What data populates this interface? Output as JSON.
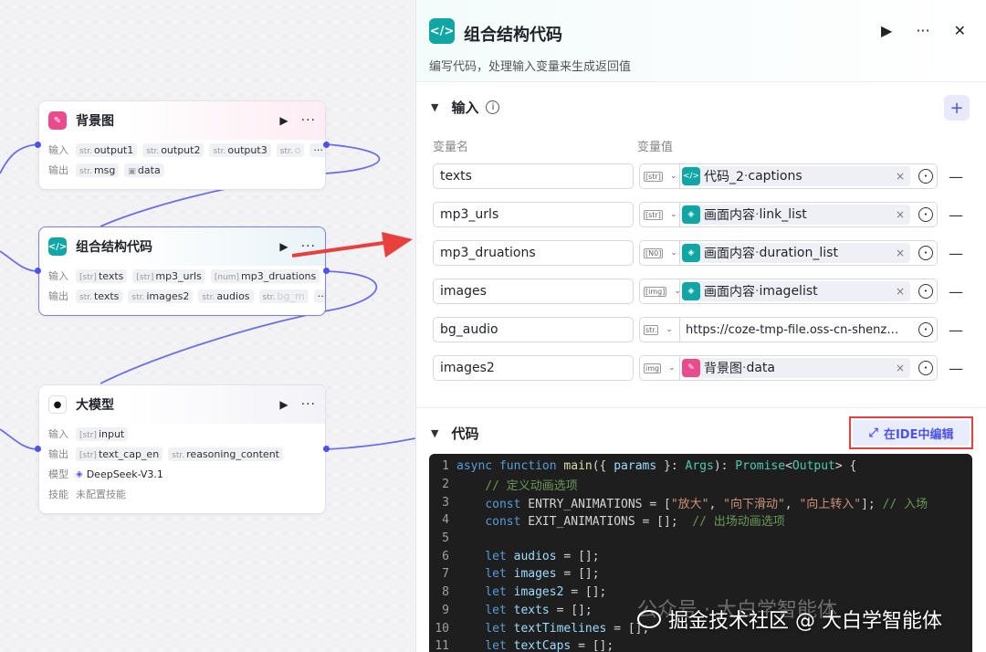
{
  "canvas": {
    "nodes": [
      {
        "title": "背景图",
        "in_label": "输入",
        "out_label": "输出",
        "inputs": [
          {
            "type": "str.",
            "name": "output1"
          },
          {
            "type": "str.",
            "name": "output2"
          },
          {
            "type": "str.",
            "name": "output3"
          },
          {
            "type": "str.",
            "name": "o"
          }
        ],
        "outputs": [
          {
            "type": "str.",
            "name": "msg"
          },
          {
            "type": "img",
            "name": "data"
          }
        ]
      },
      {
        "title": "组合结构代码",
        "in_label": "输入",
        "out_label": "输出",
        "inputs": [
          {
            "type": "[str]",
            "name": "texts"
          },
          {
            "type": "[str]",
            "name": "mp3_urls"
          },
          {
            "type": "[num]",
            "name": "mp3_druations"
          }
        ],
        "outputs": [
          {
            "type": "str.",
            "name": "texts"
          },
          {
            "type": "str.",
            "name": "images2"
          },
          {
            "type": "str.",
            "name": "audios"
          },
          {
            "type": "str.",
            "name": "bg_m"
          }
        ]
      },
      {
        "title": "大模型",
        "in_label": "输入",
        "out_label": "输出",
        "model_label": "模型",
        "model": "DeepSeek-V3.1",
        "skill_label": "技能",
        "skill": "未配置技能",
        "inputs": [
          {
            "type": "[str]",
            "name": "input"
          }
        ],
        "outputs": [
          {
            "type": "[str]",
            "name": "text_cap_en"
          },
          {
            "type": "str.",
            "name": "reasoning_content"
          }
        ]
      }
    ],
    "more": "···"
  },
  "panel": {
    "title": "组合结构代码",
    "description": "编写代码，处理输入变量来生成返回值",
    "run_icon": "play-icon",
    "more": "···",
    "close": "✕",
    "input_section": "输入",
    "col_name": "变量名",
    "col_value": "变量值",
    "rows": [
      {
        "name": "texts",
        "type": "[str]",
        "ref_node": "代码_2",
        "ref_sep": " · ",
        "ref_field": "captions",
        "icon": "code"
      },
      {
        "name": "mp3_urls",
        "type": "[str]",
        "ref_node": "画面内容",
        "ref_sep": " · ",
        "ref_field": "link_list",
        "icon": "layer"
      },
      {
        "name": "mp3_druations",
        "type": "[N0]",
        "ref_node": "画面内容",
        "ref_sep": " · ",
        "ref_field": "duration_list",
        "icon": "layer"
      },
      {
        "name": "images",
        "type": "[img]",
        "ref_node": "画面内容",
        "ref_sep": " · ",
        "ref_field": "imagelist",
        "icon": "layer"
      },
      {
        "name": "bg_audio",
        "type": "str.",
        "value": "https://coze-tmp-file.oss-cn-shenz…"
      },
      {
        "name": "images2",
        "type": "img",
        "ref_node": "背景图",
        "ref_sep": " · ",
        "ref_field": "data",
        "icon": "pink"
      }
    ],
    "code_section": "代码",
    "ide_button": "在IDE中编辑",
    "code_lines": [
      "1",
      "2",
      "3",
      "4",
      "5",
      "6",
      "7",
      "8",
      "9",
      "10",
      "11"
    ]
  },
  "watermark": {
    "line1": "公众号 · 大白学智能体",
    "line2": "掘金技术社区 @ 大白学智能体"
  },
  "colors": {
    "accent": "#4d53e8",
    "teal": "#10a6a6",
    "pink": "#e94c8c",
    "highlight": "#e8403c"
  }
}
